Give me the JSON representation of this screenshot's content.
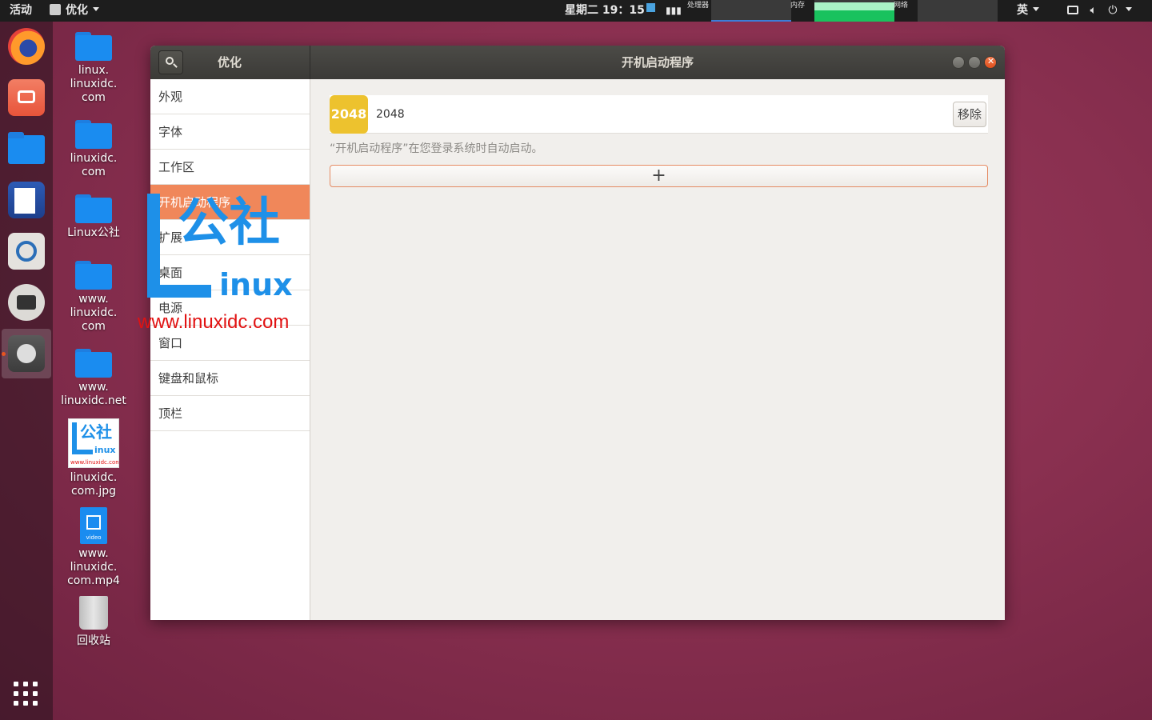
{
  "topbar": {
    "activities": "活动",
    "app_menu": "优化",
    "clock": "星期二 19：15",
    "monitor_labels": {
      "cpu": "处理器",
      "mem": "内存",
      "net": "网络"
    },
    "input_method": "英"
  },
  "desktop": {
    "items": [
      {
        "label": "linux.\nlinuxidc.\ncom",
        "type": "folder"
      },
      {
        "label": "linuxidc.\ncom",
        "type": "folder"
      },
      {
        "label": "Linux公社",
        "type": "folder"
      },
      {
        "label": "www.\nlinuxidc.\ncom",
        "type": "folder"
      },
      {
        "label": "www.\nlinuxidc.net",
        "type": "folder"
      },
      {
        "label": "linuxidc.\ncom.jpg",
        "type": "image"
      },
      {
        "label": "www.\nlinuxidc.\ncom.mp4",
        "type": "video"
      },
      {
        "label": "回收站",
        "type": "trash"
      }
    ],
    "thumb_text": {
      "brand": "公社",
      "sub": "inux",
      "url": "www.linuxidc.com"
    },
    "video_caption": "video"
  },
  "window": {
    "sidebar_title": "优化",
    "title": "开机启动程序",
    "sidebar": [
      "外观",
      "字体",
      "工作区",
      "开机启动程序",
      "扩展",
      "桌面",
      "电源",
      "窗口",
      "键盘和鼠标",
      "顶栏"
    ],
    "selected_index": 3,
    "startup_app": {
      "icon_text": "2048",
      "name": "2048",
      "remove_label": "移除"
    },
    "hint": "“开机启动程序”在您登录系统时自动启动。",
    "add_label": "+"
  },
  "watermark": {
    "brand": "公社",
    "sub": "inux",
    "url": "www.linuxidc.com"
  },
  "colors": {
    "accent": "#f0875a",
    "close": "#e95420",
    "app_icon": "#edc22e",
    "watermark_blue": "#1e90e8",
    "watermark_red": "#e11212"
  }
}
